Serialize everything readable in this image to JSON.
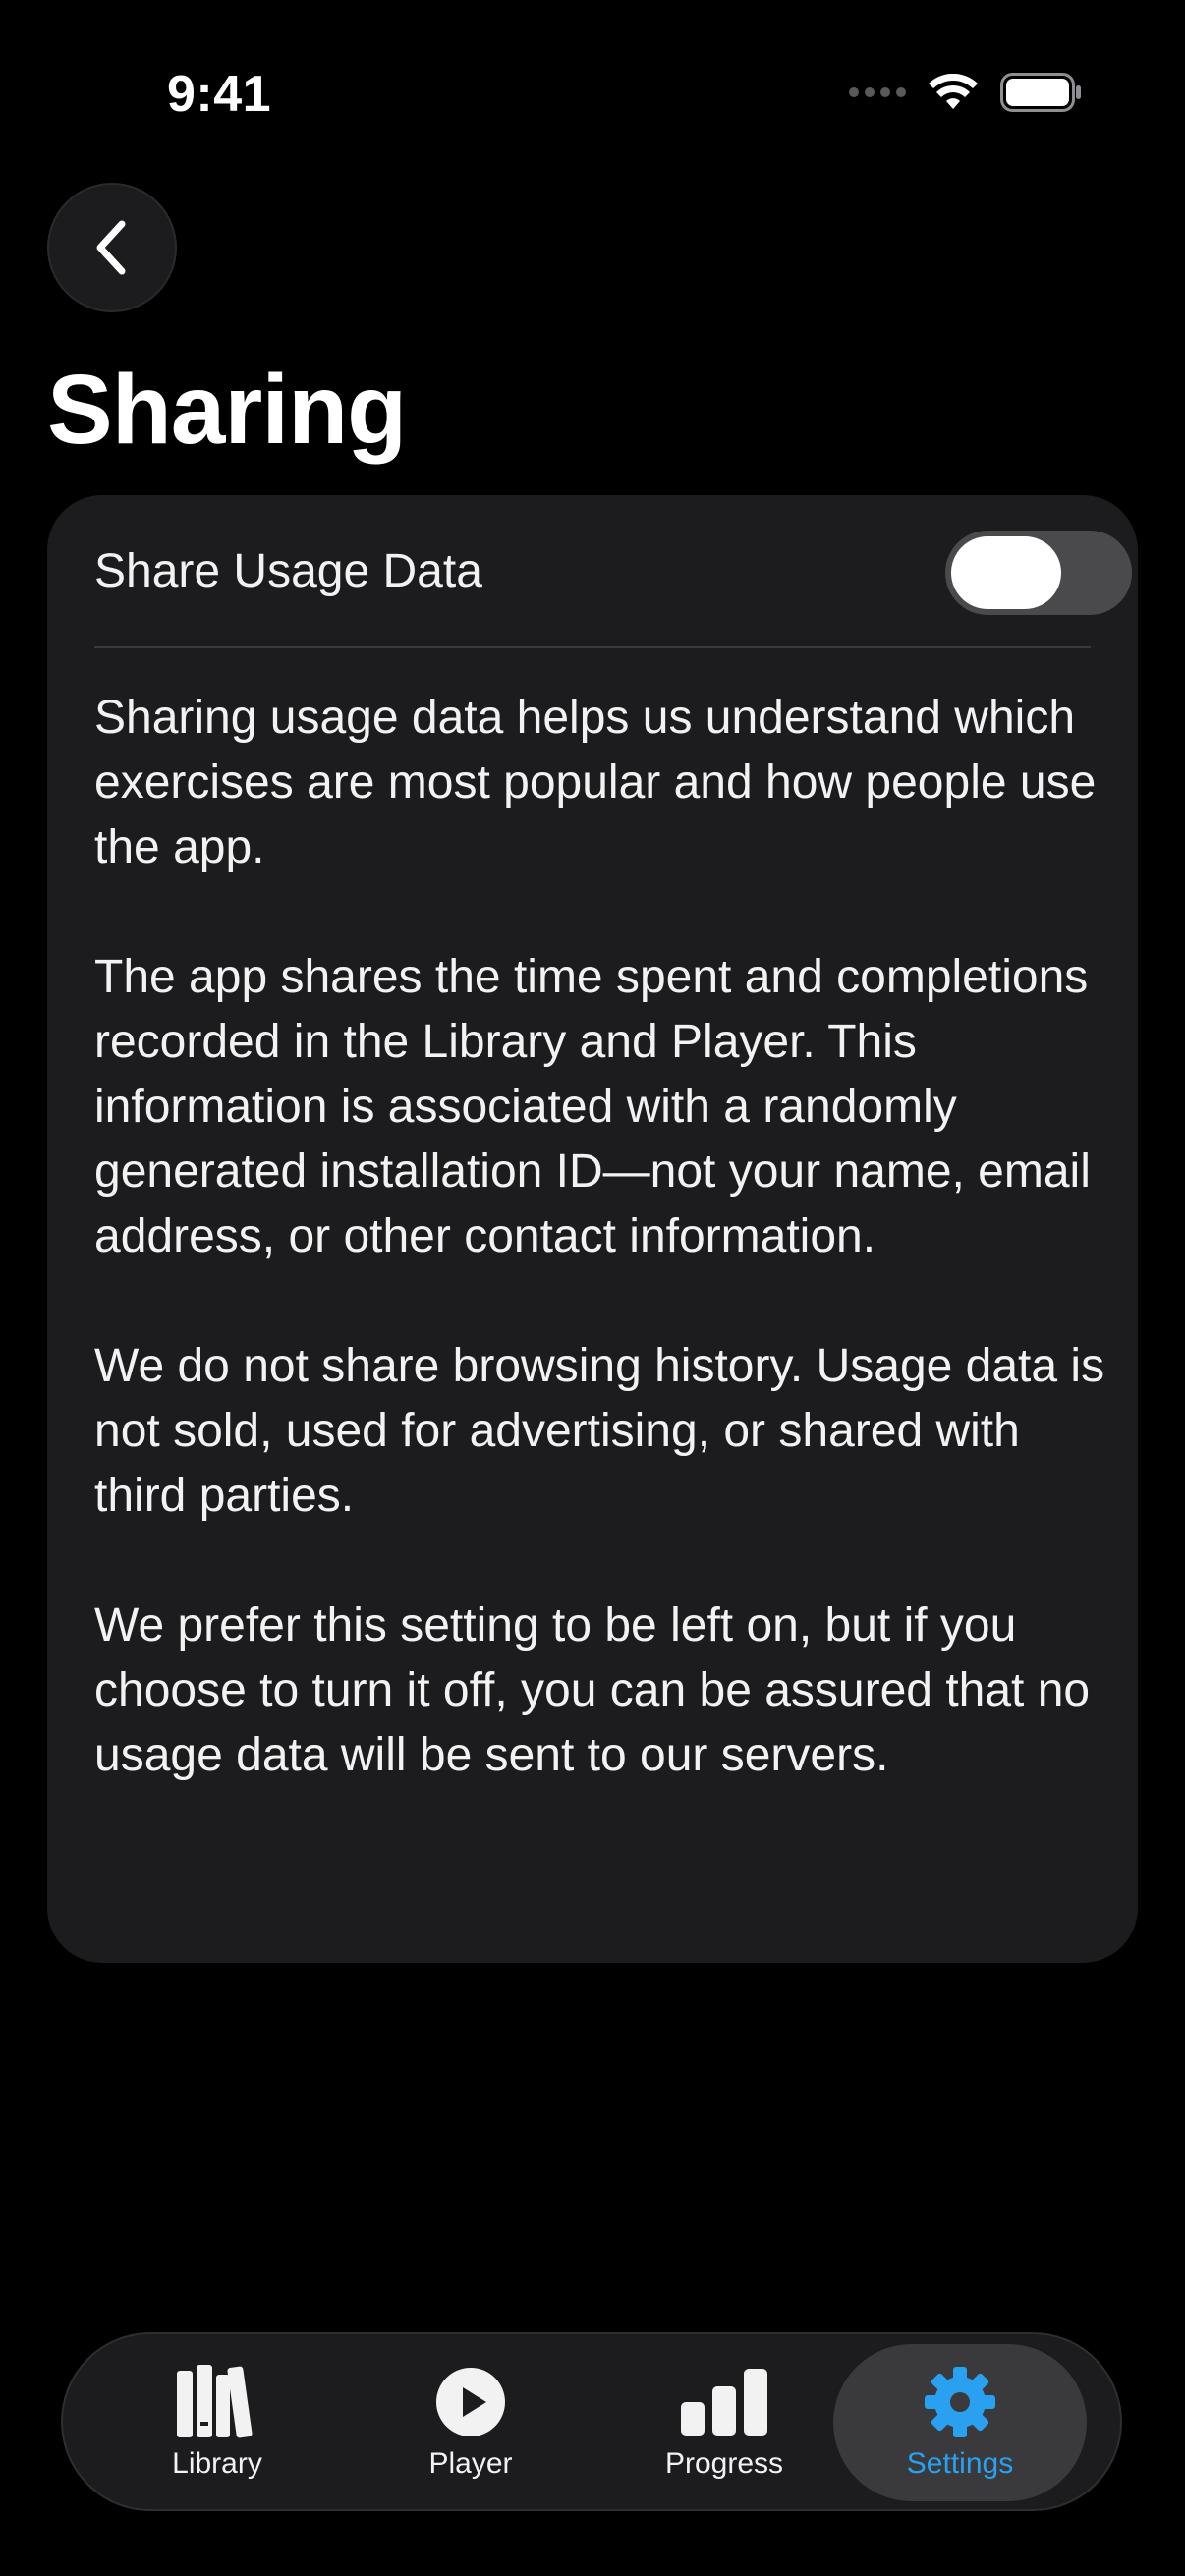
{
  "status_bar": {
    "time": "9:41"
  },
  "header": {
    "title": "Sharing"
  },
  "settings": {
    "share_usage": {
      "label": "Share Usage Data",
      "enabled": false
    }
  },
  "description": [
    "Sharing usage data helps us understand which exercises are most popular and how people use the app.",
    "The app shares the time spent and completions recorded in the Library and Player. This information is associated with a randomly generated installation ID—not your name, email address, or other contact information.",
    "We do not share browsing history. Usage data is not sold, used for advertising, or shared with third parties.",
    "We prefer this setting to be left on, but if you choose to turn it off, you can be assured that no usage data will be sent to our servers."
  ],
  "tabbar": {
    "items": [
      {
        "label": "Library",
        "icon": "books-icon"
      },
      {
        "label": "Player",
        "icon": "play-circle-icon"
      },
      {
        "label": "Progress",
        "icon": "bar-chart-icon"
      },
      {
        "label": "Settings",
        "icon": "gear-icon",
        "active": true
      }
    ]
  },
  "colors": {
    "accent": "#2aa0f0",
    "background": "#000000",
    "card": "#1c1c1e"
  }
}
